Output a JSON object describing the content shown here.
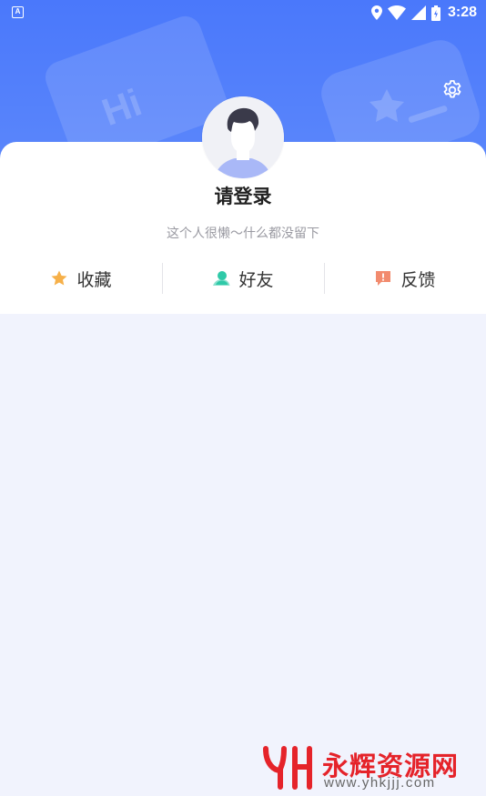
{
  "status_bar": {
    "time": "3:28",
    "left_icon_letter": "A",
    "icons": [
      "location-icon",
      "wifi-icon",
      "signal-icon",
      "battery-icon"
    ]
  },
  "header": {
    "decoration_text": "Hi",
    "settings_icon": "gear-icon"
  },
  "profile": {
    "avatar_icon": "default-avatar-icon",
    "login_text": "请登录",
    "signature": "这个人很懒〜什么都没留下"
  },
  "actions": [
    {
      "label": "收藏",
      "icon": "star-icon",
      "color": "#f6b049"
    },
    {
      "label": "好友",
      "icon": "friend-icon",
      "color": "#2fc9a8"
    },
    {
      "label": "反馈",
      "icon": "feedback-icon",
      "color": "#f28b6e"
    }
  ],
  "colors": {
    "header_blue": "#4a78fb",
    "page_background": "#f1f3fd"
  },
  "watermark": {
    "name": "永辉资源网",
    "url": "www.yhkjjj.com"
  }
}
